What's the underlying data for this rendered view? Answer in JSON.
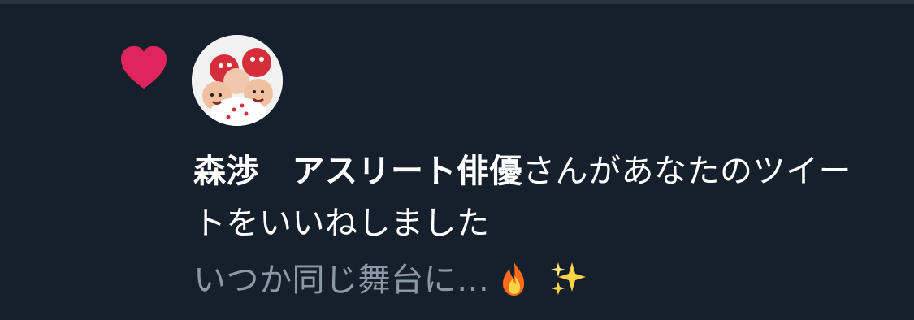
{
  "notification": {
    "icon": "heart-icon",
    "icon_color": "#e0245e",
    "avatar": "user-avatar",
    "user_name": "森渉　アスリート俳優",
    "action_text": "さんがあなたのツイートをいいねしました",
    "tweet_excerpt": "いつか同じ舞台に…",
    "emojis": [
      "fire",
      "sparkles"
    ]
  },
  "colors": {
    "background": "#16202c",
    "primary_text": "#ffffff",
    "secondary_text": "#8b98a5",
    "accent": "#e0245e"
  }
}
